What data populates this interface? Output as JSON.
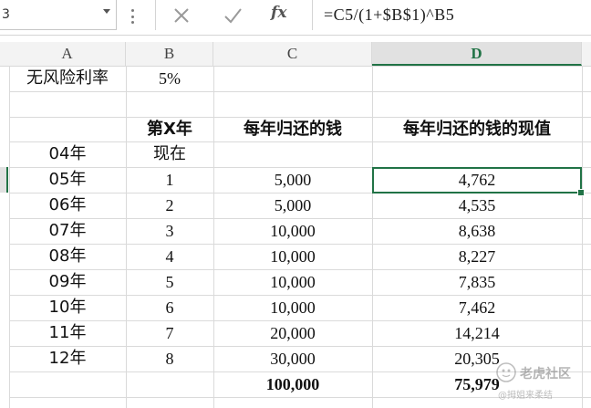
{
  "formula_bar": {
    "name_box": "3",
    "formula": "=C5/(1+$B$1)^B5"
  },
  "columns": [
    "A",
    "B",
    "C",
    "D"
  ],
  "active_column": "D",
  "rows": [
    {
      "a": "无风险利率",
      "b": "5%",
      "c": "",
      "d": ""
    },
    {
      "a": "",
      "b": "",
      "c": "",
      "d": ""
    },
    {
      "a": "",
      "b": "第X年",
      "c": "每年归还的钱",
      "d": "每年归还的钱的现值"
    },
    {
      "a": "04年",
      "b": "现在",
      "c": "",
      "d": ""
    },
    {
      "a": "05年",
      "b": "1",
      "c": "5,000",
      "d": "4,762"
    },
    {
      "a": "06年",
      "b": "2",
      "c": "5,000",
      "d": "4,535"
    },
    {
      "a": "07年",
      "b": "3",
      "c": "10,000",
      "d": "8,638"
    },
    {
      "a": "08年",
      "b": "4",
      "c": "10,000",
      "d": "8,227"
    },
    {
      "a": "09年",
      "b": "5",
      "c": "10,000",
      "d": "7,835"
    },
    {
      "a": "10年",
      "b": "6",
      "c": "10,000",
      "d": "7,462"
    },
    {
      "a": "11年",
      "b": "7",
      "c": "20,000",
      "d": "14,214"
    },
    {
      "a": "12年",
      "b": "8",
      "c": "30,000",
      "d": "20,305"
    },
    {
      "a": "",
      "b": "",
      "c": "100,000",
      "d": "75,979"
    }
  ],
  "selected_cell_value": "4,762",
  "colors": {
    "accent": "#217346",
    "grid": "#dadada",
    "header_bg": "#f3f3f3"
  },
  "icons": {
    "cancel": "close-icon",
    "enter": "check-icon",
    "function": "fx-icon"
  },
  "watermark": {
    "brand": "老虎社区",
    "caption": "@拇姐来柔结"
  }
}
